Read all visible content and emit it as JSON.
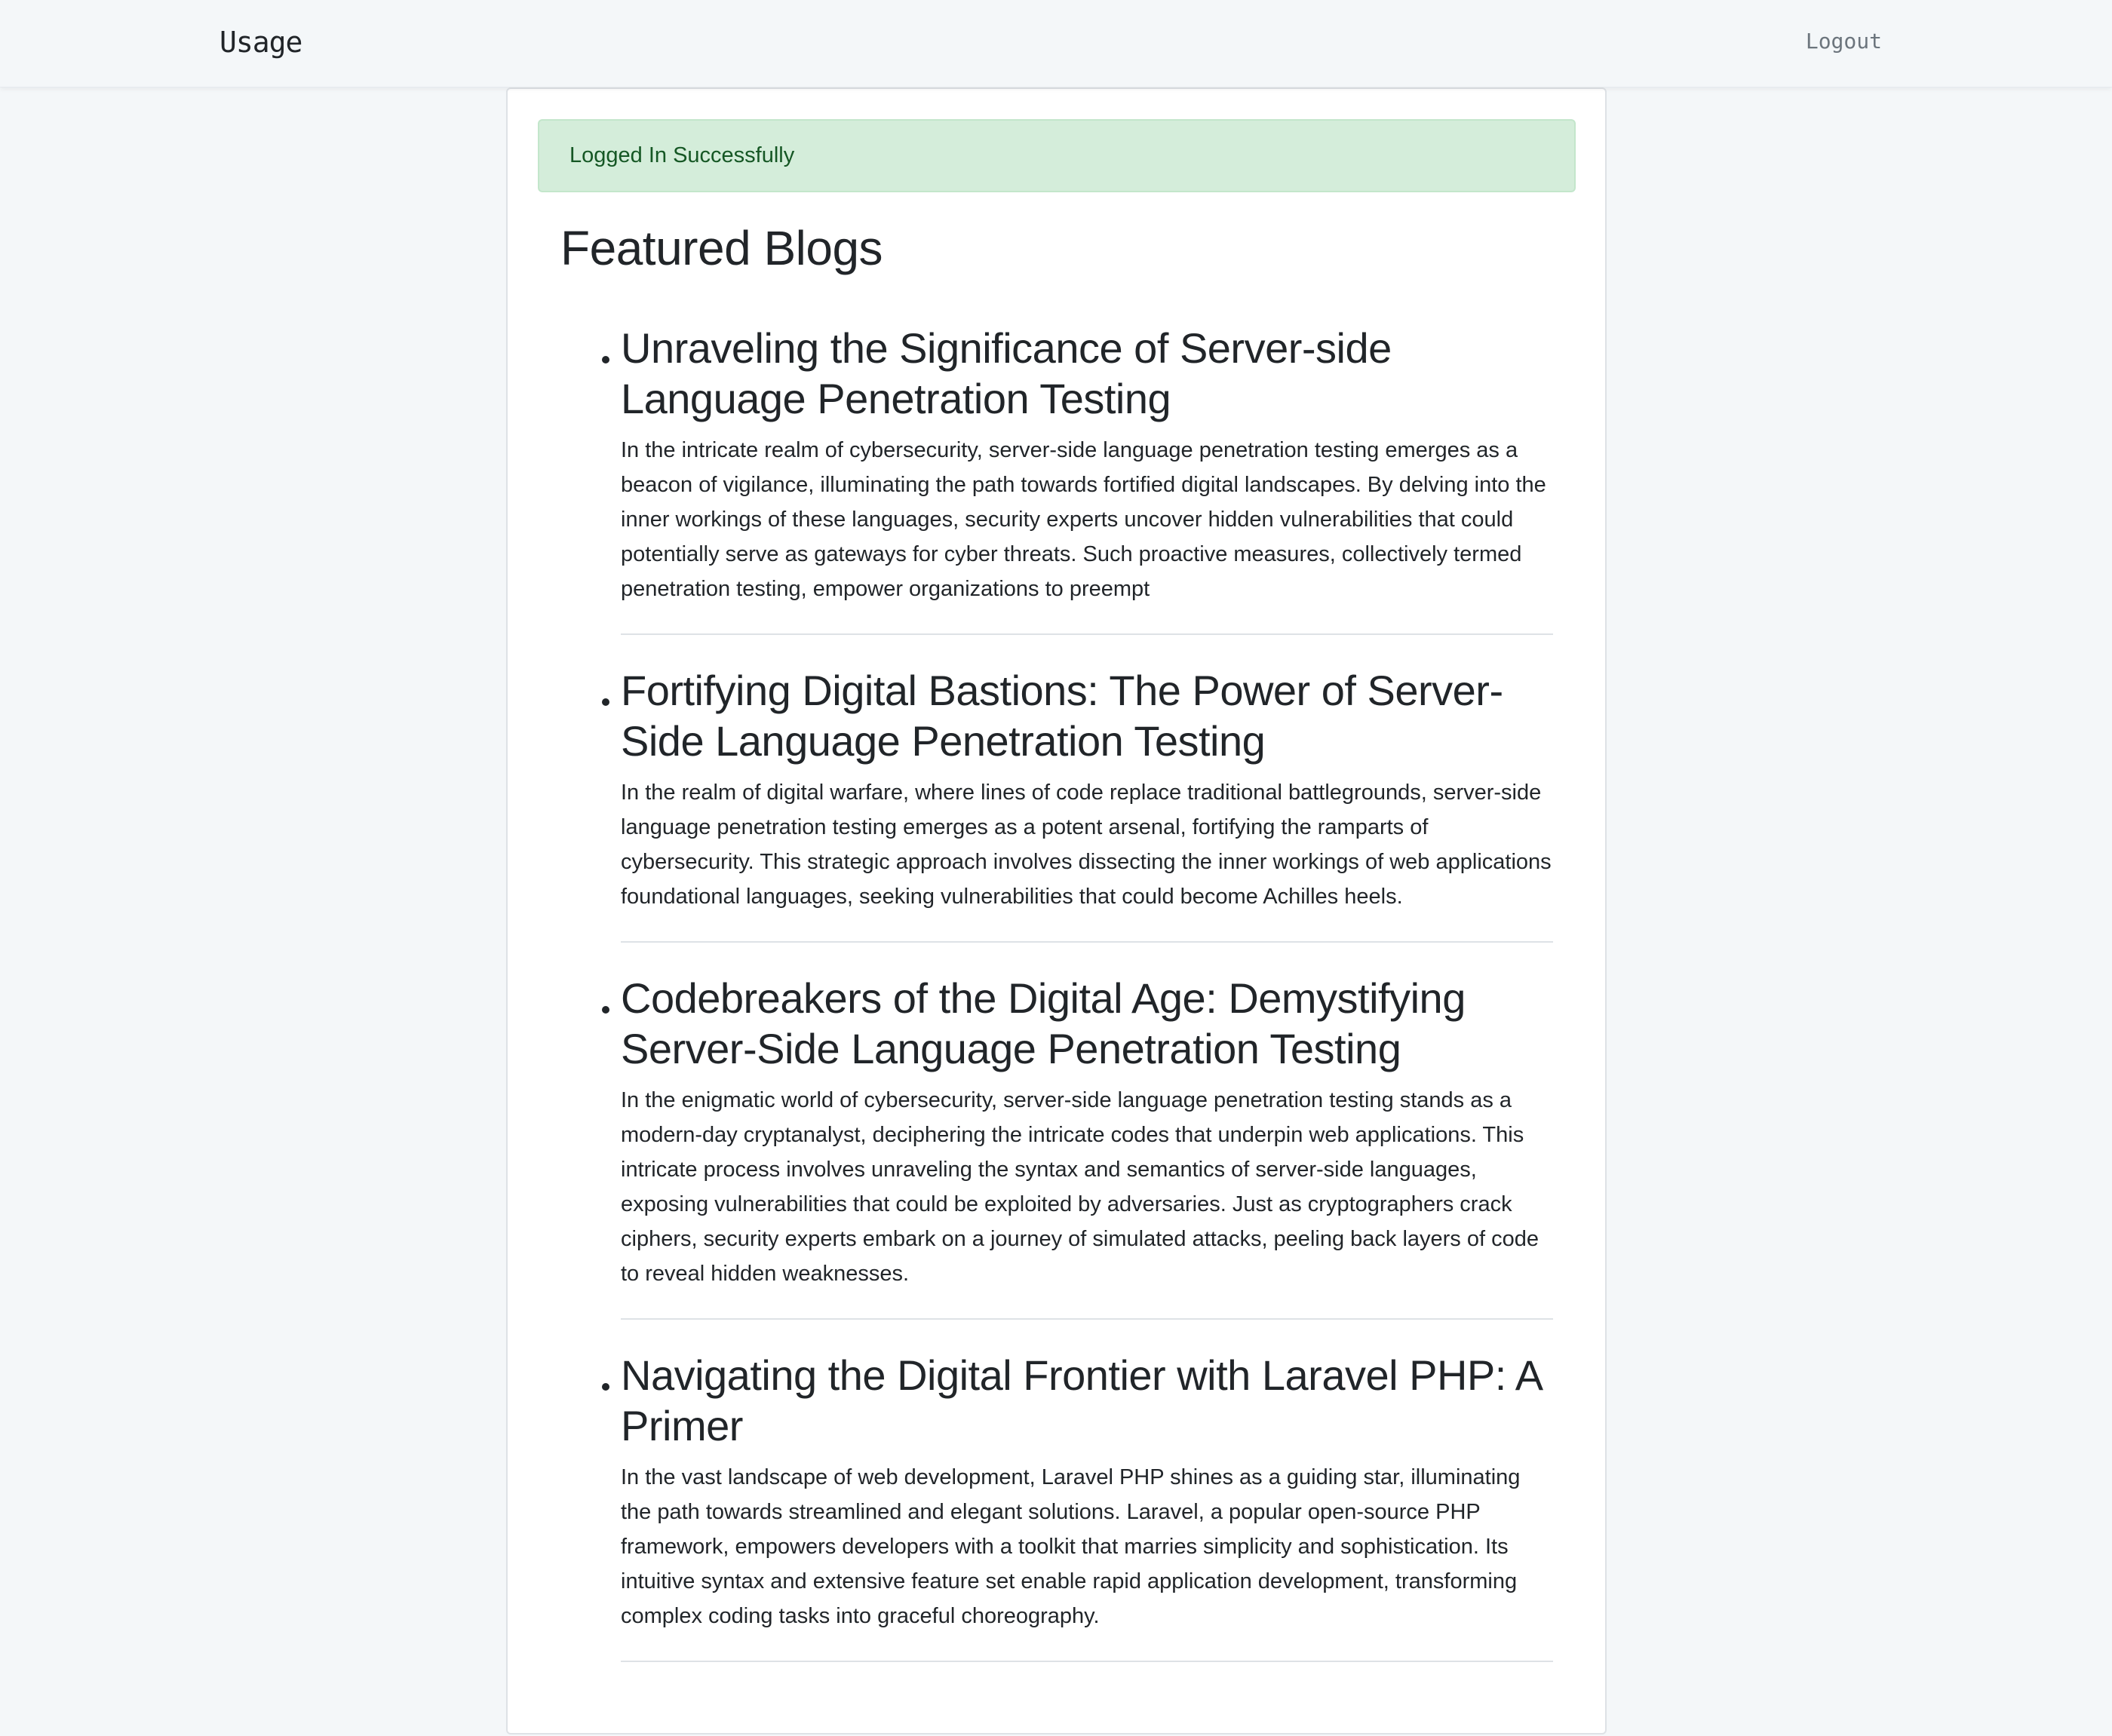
{
  "navbar": {
    "brand": "Usage",
    "logout_label": "Logout"
  },
  "alert": {
    "message": "Logged In Successfully"
  },
  "main": {
    "title": "Featured Blogs",
    "blogs": [
      {
        "title": "Unraveling the Significance of Server-side Language Penetration Testing",
        "excerpt": "In the intricate realm of cybersecurity, server-side language penetration testing emerges as a beacon of vigilance, illuminating the path towards fortified digital landscapes. By delving into the inner workings of these languages, security experts uncover hidden vulnerabilities that could potentially serve as gateways for cyber threats. Such proactive measures, collectively termed penetration testing, empower organizations to preempt"
      },
      {
        "title": "Fortifying Digital Bastions: The Power of Server-Side Language Penetration Testing",
        "excerpt": "In the realm of digital warfare, where lines of code replace traditional battlegrounds, server-side language penetration testing emerges as a potent arsenal, fortifying the ramparts of cybersecurity. This strategic approach involves dissecting the inner workings of web applications foundational languages, seeking vulnerabilities that could become Achilles heels."
      },
      {
        "title": "Codebreakers of the Digital Age: Demystifying Server-Side Language Penetration Testing",
        "excerpt": "In the enigmatic world of cybersecurity, server-side language penetration testing stands as a modern-day cryptanalyst, deciphering the intricate codes that underpin web applications. This intricate process involves unraveling the syntax and semantics of server-side languages, exposing vulnerabilities that could be exploited by adversaries. Just as cryptographers crack ciphers, security experts embark on a journey of simulated attacks, peeling back layers of code to reveal hidden weaknesses."
      },
      {
        "title": "Navigating the Digital Frontier with Laravel PHP: A Primer",
        "excerpt": "In the vast landscape of web development, Laravel PHP shines as a guiding star, illuminating the path towards streamlined and elegant solutions. Laravel, a popular open-source PHP framework, empowers developers with a toolkit that marries simplicity and sophistication. Its intuitive syntax and extensive feature set enable rapid application development, transforming complex coding tasks into graceful choreography."
      }
    ]
  },
  "colors": {
    "page_background": "#f4f7f9",
    "alert_background": "#d4edda",
    "alert_text": "#155724",
    "text": "#212529",
    "muted": "#6c757d"
  }
}
